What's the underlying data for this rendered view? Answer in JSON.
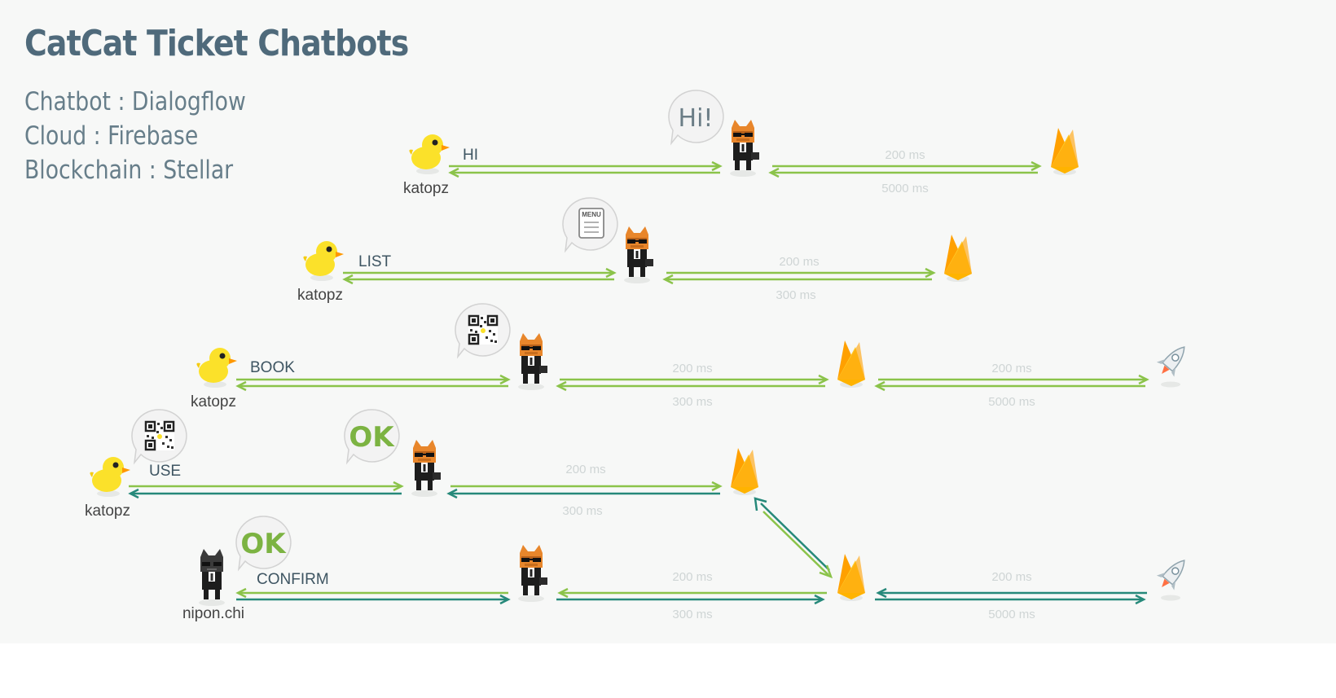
{
  "title": "CatCat Ticket Chatbots",
  "stack": [
    "Chatbot : Dialogflow",
    "Cloud : Firebase",
    "Blockchain : Stellar"
  ],
  "rows": [
    {
      "user": "katopz",
      "message": "HI",
      "bubble": "Hi!",
      "t1": "200 ms",
      "t2": "5000 ms"
    },
    {
      "user": "katopz",
      "message": "LIST",
      "bubble": "MENU",
      "t1": "200 ms",
      "t2": "300 ms"
    },
    {
      "user": "katopz",
      "message": "BOOK",
      "t1": "200 ms",
      "t2": "300 ms",
      "t3": "200 ms",
      "t4": "5000 ms"
    },
    {
      "user": "katopz",
      "message": "USE",
      "bubble": "OK",
      "t1": "200 ms",
      "t2": "300 ms"
    },
    {
      "user": "nipon.chi",
      "message": "CONFIRM",
      "bubble": "OK",
      "t1": "200 ms",
      "t2": "300 ms",
      "t3": "200 ms",
      "t4": "5000 ms"
    }
  ],
  "colors": {
    "green": "#8bc34a",
    "teal": "#26897a",
    "title": "#4f6a7b",
    "ok": "#7cb342"
  }
}
